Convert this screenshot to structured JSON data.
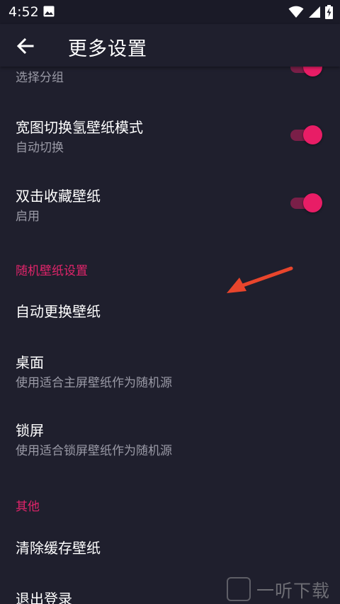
{
  "status_bar": {
    "time": "4:52",
    "icons": [
      "image-icon",
      "wifi-icon",
      "signal-icon",
      "battery-charging-icon"
    ]
  },
  "app_bar": {
    "back_icon": "arrow-left-icon",
    "title": "更多设置"
  },
  "settings": {
    "partial_item": {
      "subtitle": "选择分组",
      "switch_on": true
    },
    "items": [
      {
        "title": "宽图切换氢壁纸模式",
        "subtitle": "自动切换",
        "switch_on": true
      },
      {
        "title": "双击收藏壁纸",
        "subtitle": "启用",
        "switch_on": true
      }
    ],
    "random_section": {
      "header": "随机壁纸设置",
      "items": [
        {
          "title": "自动更换壁纸"
        },
        {
          "title": "桌面",
          "subtitle": "使用适合主屏壁纸作为随机源"
        },
        {
          "title": "锁屏",
          "subtitle": "使用适合锁屏壁纸作为随机源"
        }
      ]
    },
    "other_section": {
      "header": "其他",
      "items": [
        {
          "title": "清除缓存壁纸"
        },
        {
          "title": "退出登录"
        }
      ]
    }
  },
  "colors": {
    "background": "#1f1f2d",
    "accent": "#e0246a",
    "switch_thumb": "#e81d66",
    "switch_track": "#7a1f48",
    "annotation_arrow": "#e8452c"
  },
  "watermark": {
    "text": "一听下载"
  }
}
